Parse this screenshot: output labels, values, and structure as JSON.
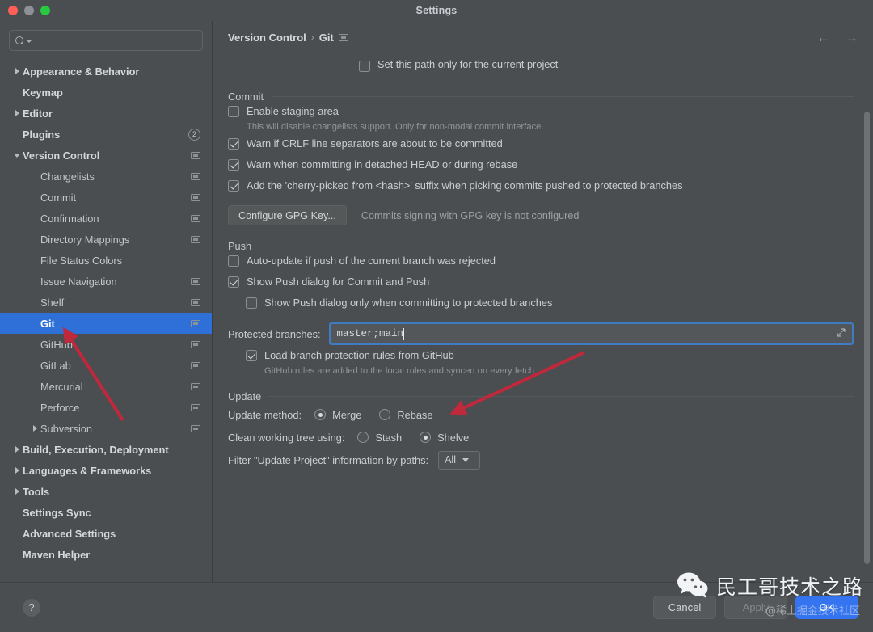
{
  "window": {
    "title": "Settings",
    "traffic_lights": [
      "close",
      "minimize",
      "zoom"
    ]
  },
  "sidebar": {
    "search": {
      "value": "",
      "placeholder": ""
    },
    "items": [
      {
        "label": "Appearance & Behavior",
        "level": 0,
        "expandable": true,
        "expanded": false,
        "scope_icon": false,
        "badge": null,
        "selected": false
      },
      {
        "label": "Keymap",
        "level": 0,
        "expandable": false,
        "expanded": false,
        "scope_icon": false,
        "badge": null,
        "selected": false
      },
      {
        "label": "Editor",
        "level": 0,
        "expandable": true,
        "expanded": false,
        "scope_icon": false,
        "badge": null,
        "selected": false
      },
      {
        "label": "Plugins",
        "level": 0,
        "expandable": false,
        "expanded": false,
        "scope_icon": false,
        "badge": "2",
        "selected": false
      },
      {
        "label": "Version Control",
        "level": 0,
        "expandable": true,
        "expanded": true,
        "scope_icon": true,
        "badge": null,
        "selected": false
      },
      {
        "label": "Changelists",
        "level": 1,
        "expandable": false,
        "expanded": false,
        "scope_icon": true,
        "badge": null,
        "selected": false
      },
      {
        "label": "Commit",
        "level": 1,
        "expandable": false,
        "expanded": false,
        "scope_icon": true,
        "badge": null,
        "selected": false
      },
      {
        "label": "Confirmation",
        "level": 1,
        "expandable": false,
        "expanded": false,
        "scope_icon": true,
        "badge": null,
        "selected": false
      },
      {
        "label": "Directory Mappings",
        "level": 1,
        "expandable": false,
        "expanded": false,
        "scope_icon": true,
        "badge": null,
        "selected": false
      },
      {
        "label": "File Status Colors",
        "level": 1,
        "expandable": false,
        "expanded": false,
        "scope_icon": false,
        "badge": null,
        "selected": false
      },
      {
        "label": "Issue Navigation",
        "level": 1,
        "expandable": false,
        "expanded": false,
        "scope_icon": true,
        "badge": null,
        "selected": false
      },
      {
        "label": "Shelf",
        "level": 1,
        "expandable": false,
        "expanded": false,
        "scope_icon": true,
        "badge": null,
        "selected": false
      },
      {
        "label": "Git",
        "level": 1,
        "expandable": false,
        "expanded": false,
        "scope_icon": true,
        "badge": null,
        "selected": true
      },
      {
        "label": "GitHub",
        "level": 1,
        "expandable": false,
        "expanded": false,
        "scope_icon": true,
        "badge": null,
        "selected": false
      },
      {
        "label": "GitLab",
        "level": 1,
        "expandable": false,
        "expanded": false,
        "scope_icon": true,
        "badge": null,
        "selected": false
      },
      {
        "label": "Mercurial",
        "level": 1,
        "expandable": false,
        "expanded": false,
        "scope_icon": true,
        "badge": null,
        "selected": false
      },
      {
        "label": "Perforce",
        "level": 1,
        "expandable": false,
        "expanded": false,
        "scope_icon": true,
        "badge": null,
        "selected": false
      },
      {
        "label": "Subversion",
        "level": 1,
        "expandable": true,
        "expanded": false,
        "scope_icon": true,
        "badge": null,
        "selected": false
      },
      {
        "label": "Build, Execution, Deployment",
        "level": 0,
        "expandable": true,
        "expanded": false,
        "scope_icon": false,
        "badge": null,
        "selected": false
      },
      {
        "label": "Languages & Frameworks",
        "level": 0,
        "expandable": true,
        "expanded": false,
        "scope_icon": false,
        "badge": null,
        "selected": false
      },
      {
        "label": "Tools",
        "level": 0,
        "expandable": true,
        "expanded": false,
        "scope_icon": false,
        "badge": null,
        "selected": false
      },
      {
        "label": "Settings Sync",
        "level": 0,
        "expandable": false,
        "expanded": false,
        "scope_icon": false,
        "badge": null,
        "selected": false
      },
      {
        "label": "Advanced Settings",
        "level": 0,
        "expandable": false,
        "expanded": false,
        "scope_icon": false,
        "badge": null,
        "selected": false
      },
      {
        "label": "Maven Helper",
        "level": 0,
        "expandable": false,
        "expanded": false,
        "scope_icon": false,
        "badge": null,
        "selected": false
      }
    ]
  },
  "breadcrumb": {
    "parent": "Version Control",
    "separator": "›",
    "current": "Git"
  },
  "nav": {
    "back": "←",
    "forward": "→"
  },
  "main": {
    "path_scope": {
      "label": "Set this path only for the current project",
      "checked": false
    },
    "commit": {
      "title": "Commit",
      "options": [
        {
          "label": "Enable staging area",
          "checked": false,
          "indented": false,
          "hint": "This will disable changelists support. Only for non-modal commit interface."
        },
        {
          "label": "Warn if CRLF line separators are about to be committed",
          "checked": true,
          "indented": false,
          "hint": null
        },
        {
          "label": "Warn when committing in detached HEAD or during rebase",
          "checked": true,
          "indented": false,
          "hint": null
        },
        {
          "label": "Add the 'cherry-picked from <hash>' suffix when picking commits pushed to protected branches",
          "checked": true,
          "indented": false,
          "hint": null
        }
      ],
      "gpg_button": "Configure GPG Key...",
      "gpg_status": "Commits signing with GPG key is not configured"
    },
    "push": {
      "title": "Push",
      "options": [
        {
          "label": "Auto-update if push of the current branch was rejected",
          "checked": false,
          "indented": false
        },
        {
          "label": "Show Push dialog for Commit and Push",
          "checked": true,
          "indented": false
        },
        {
          "label": "Show Push dialog only when committing to protected branches",
          "checked": false,
          "indented": true
        }
      ],
      "protected_branches": {
        "label": "Protected branches:",
        "value": "master;main",
        "focused": true,
        "expand_icon": "expand-field-icon"
      },
      "github_rules": {
        "label": "Load branch protection rules from GitHub",
        "checked": true,
        "hint": "GitHub rules are added to the local rules and synced on every fetch"
      }
    },
    "update": {
      "title": "Update",
      "method": {
        "label": "Update method:",
        "options": [
          {
            "label": "Merge",
            "selected": true
          },
          {
            "label": "Rebase",
            "selected": false
          }
        ]
      },
      "clean_tree": {
        "label": "Clean working tree using:",
        "options": [
          {
            "label": "Stash",
            "selected": false
          },
          {
            "label": "Shelve",
            "selected": true
          }
        ]
      },
      "filter": {
        "label": "Filter \"Update Project\" information by paths:",
        "value": "All"
      }
    }
  },
  "footer": {
    "help": "?",
    "cancel": "Cancel",
    "apply": "Apply",
    "ok": "OK"
  },
  "watermark": {
    "title": "民工哥技术之路",
    "subtitle": "@稀土掘金技术社区"
  },
  "colors": {
    "selection_blue": "#2f6fd8",
    "primary_button": "#3574f0",
    "focus_border": "#3f7cc4",
    "annotation_red": "#c0283c",
    "panel_bg": "#4a4e51"
  }
}
